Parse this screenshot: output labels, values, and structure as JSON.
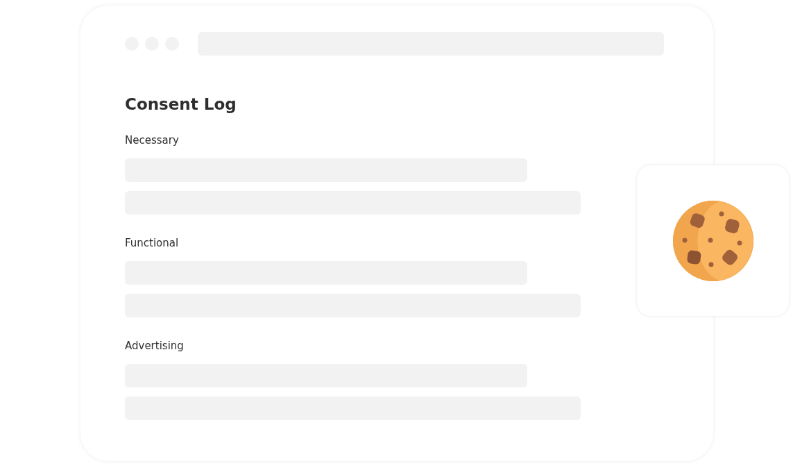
{
  "title": "Consent Log",
  "sections": [
    {
      "label": "Necessary"
    },
    {
      "label": "Functional"
    },
    {
      "label": "Advertising"
    }
  ]
}
